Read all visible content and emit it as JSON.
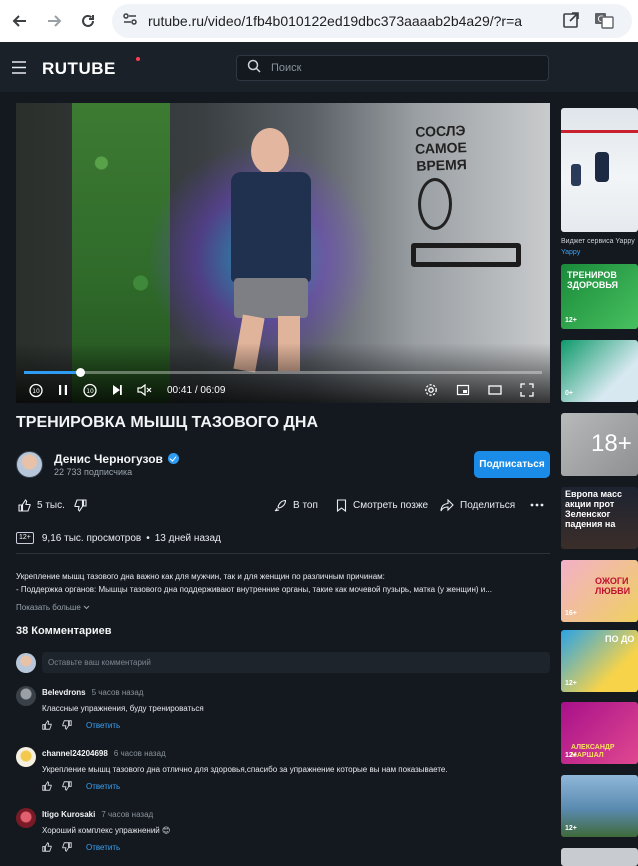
{
  "browser": {
    "url": "rutube.ru/video/1fb4b010122ed19dbc373aaaab2b4a29/?r=a"
  },
  "header": {
    "logo": "RUTUBE",
    "search_placeholder": "Поиск"
  },
  "player": {
    "current_time": "00:41",
    "separator": "/",
    "duration": "06:09",
    "progress_fraction": 0.11,
    "skip_back_label": "10",
    "skip_forward_label": "10",
    "scene_sign_text": "СОСЛЭ САМОЕ ВРЕМЯ"
  },
  "video": {
    "title": "ТРЕНИРОВКА МЫШЦ ТАЗОВОГО ДНА",
    "channel_name": "Денис Черногузов",
    "subscribers": "22 733 подписчика",
    "subscribe_label": "Подписаться",
    "likes": "5 тыс.",
    "top_label": "В топ",
    "watch_later_label": "Смотреть позже",
    "share_label": "Поделиться",
    "age_rating": "12+",
    "views": "9,16 тыс. просмотров",
    "dot": "•",
    "published": "13 дней назад",
    "description_line1": "Укрепление мышц тазового дна важно как для мужчин, так и для женщин по различным причинам:",
    "description_line2": "- Поддержка органов: Мышцы тазового дна поддерживают внутренние органы, такие как мочевой пузырь, матка (у женщин) и...",
    "show_more": "Показать больше"
  },
  "comments": {
    "title": "38 Комментариев",
    "input_placeholder": "Оставьте ваш комментарий",
    "reply_label": "Ответить",
    "items": [
      {
        "author": "Belevdrons",
        "time": "5 часов назад",
        "text": "Классные упражнения, буду тренироваться"
      },
      {
        "author": "channel24204698",
        "time": "6 часов назад",
        "text": "Укрепление мышц тазового дна отлично для  здоровья,спасибо за упражнение которые вы нам показываете."
      },
      {
        "author": "Itigo Kurosaki",
        "time": "7 часов назад",
        "text": "Хороший комплекс упражнений 😊"
      }
    ]
  },
  "sidebar": {
    "widget_caption": "Виджет сервиса Yappy",
    "widget_sub": "Yappy",
    "items": [
      {
        "text": "ТРЕНИРОВ ЗДОРОВЬЯ",
        "age": "12+"
      },
      {
        "text": "",
        "age": "0+"
      },
      {
        "text": "18+",
        "age": ""
      },
      {
        "text": "Европа масс акции прот Зеленског падения на",
        "age": ""
      },
      {
        "text": "ОЖОГИ ЛЮБВИ",
        "age": "16+"
      },
      {
        "text": "ПО ДО",
        "age": "12+"
      },
      {
        "text": "АЛЕКСАНДР МАРШАЛ",
        "age": "12+"
      },
      {
        "text": "",
        "age": "12+"
      }
    ]
  }
}
